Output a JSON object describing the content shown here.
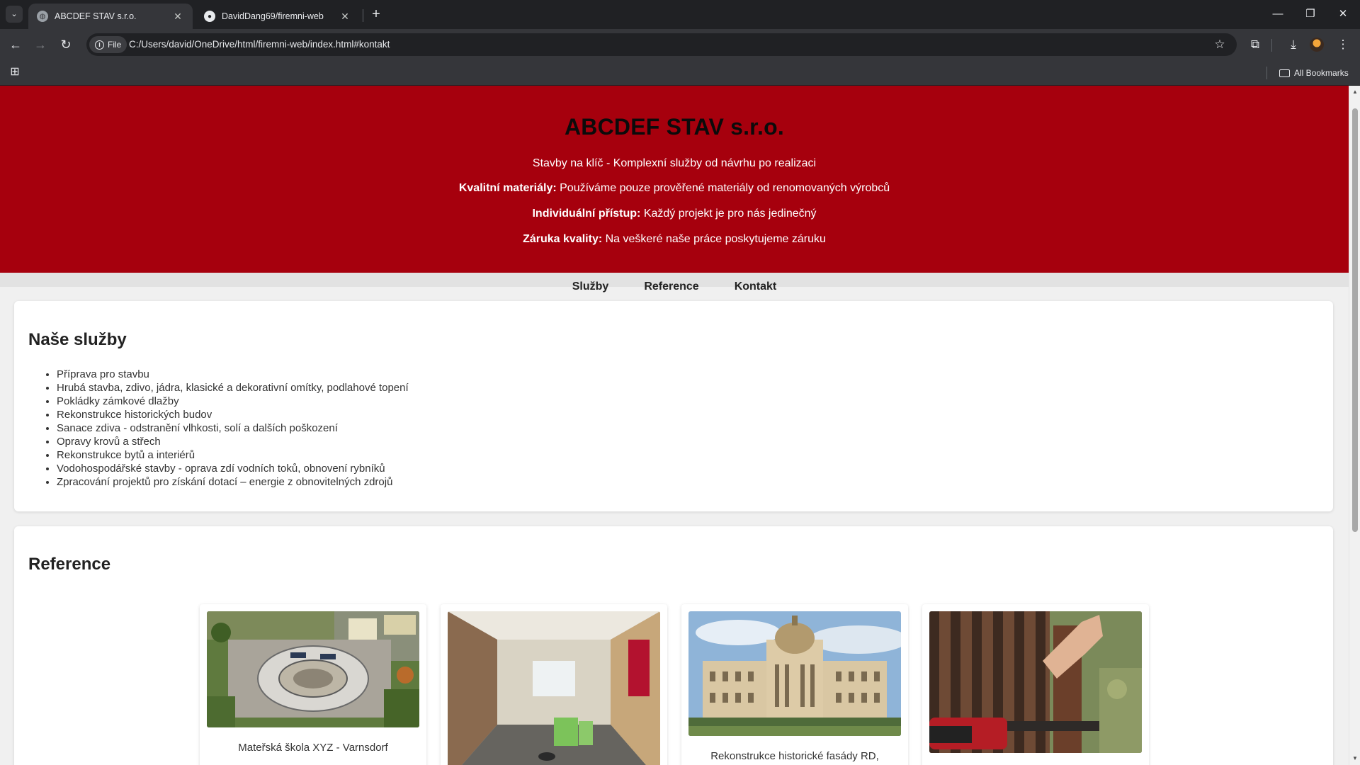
{
  "browser": {
    "tabs": [
      {
        "title": "ABCDEF STAV s.r.o.",
        "active": true
      },
      {
        "title": "DavidDang69/firemni-web",
        "active": false
      }
    ],
    "address": {
      "scheme_label": "File",
      "url": "C:/Users/david/OneDrive/html/firemni-web/index.html#kontakt"
    },
    "bookmarks": {
      "all_label": "All Bookmarks"
    },
    "icons": {
      "tab_search": "chevron-down-icon",
      "back": "arrow-left-icon",
      "forward": "arrow-right-icon",
      "reload": "reload-icon",
      "bookmark_star": "star-icon",
      "extensions": "puzzle-icon",
      "downloads": "download-icon",
      "menu": "kebab-menu-icon"
    }
  },
  "page": {
    "header": {
      "title": "ABCDEF STAV s.r.o.",
      "tagline": "Stavby na klíč - Komplexní služby od návrhu po realizaci",
      "features": [
        {
          "label": "Kvalitní materiály:",
          "text": " Používáme pouze prověřené materiály od renomovaných výrobců"
        },
        {
          "label": "Individuální přístup:",
          "text": " Každý projekt je pro nás jedinečný"
        },
        {
          "label": "Záruka kvality:",
          "text": " Na veškeré naše práce poskytujeme záruku"
        }
      ]
    },
    "nav": [
      "Služby",
      "Reference",
      "Kontakt"
    ],
    "services": {
      "heading": "Naše služby",
      "items": [
        "Příprava pro stavbu",
        "Hrubá stavba, zdivo, jádra, klasické a dekorativní omítky, podlahové topení",
        "Pokládky zámkové dlažby",
        "Rekonstrukce historických budov",
        "Sanace zdiva - odstranění vlhkosti, solí a dalších poškození",
        "Opravy krovů a střech",
        "Rekonstrukce bytů a interiérů",
        "Vodohospodářské stavby - oprava zdí vodních toků, obnovení rybníků",
        "Zpracování projektů pro získání dotací – energie z obnovitelných zdrojů"
      ]
    },
    "references": {
      "heading": "Reference",
      "items": [
        {
          "caption": "Mateřská škola XYZ - Varnsdorf"
        },
        {
          "caption": ""
        },
        {
          "caption": "Rekonstrukce historické fasády RD,"
        },
        {
          "caption": ""
        }
      ]
    }
  },
  "colors": {
    "hero": "#a6000d",
    "nav": "#e2e2e2",
    "page_bg": "#f0f0f0",
    "chrome_dark": "#202124",
    "chrome": "#35363a"
  }
}
